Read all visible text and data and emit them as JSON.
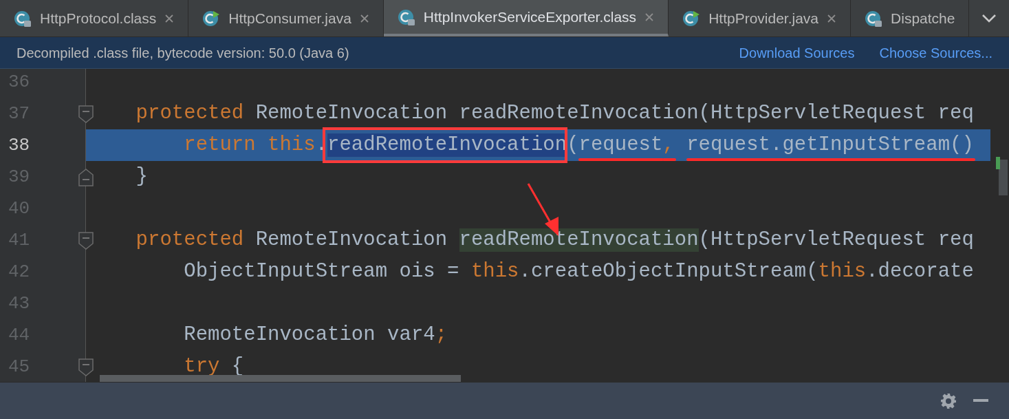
{
  "tabs": [
    {
      "label": "HttpProtocol.class",
      "kind": "class",
      "selected": false,
      "closable": true
    },
    {
      "label": "HttpConsumer.java",
      "kind": "java",
      "selected": false,
      "closable": true
    },
    {
      "label": "HttpInvokerServiceExporter.class",
      "kind": "class",
      "selected": true,
      "closable": true
    },
    {
      "label": "HttpProvider.java",
      "kind": "java",
      "selected": false,
      "closable": true
    },
    {
      "label": "Dispatche",
      "kind": "class",
      "selected": false,
      "closable": false
    }
  ],
  "info_bar": {
    "text": "Decompiled .class file, bytecode version: 50.0 (Java 6)",
    "links": [
      "Download Sources",
      "Choose Sources..."
    ]
  },
  "editor": {
    "lines": [
      {
        "number": "36",
        "selected": false,
        "fold_start": false,
        "fold_end": false
      },
      {
        "number": "37",
        "selected": false,
        "fold_start": true,
        "fold_end": false,
        "tokens": [
          {
            "text": "    protected",
            "kind": "keyword"
          },
          {
            "text": " RemoteInvocation readRemoteInvocation(HttpServletRequest req",
            "kind": "plain"
          }
        ]
      },
      {
        "number": "38",
        "selected": true,
        "fold_start": false,
        "fold_end": false,
        "tokens": [
          {
            "text": "        return this",
            "kind": "keyword"
          },
          {
            "text": ".",
            "kind": "plain"
          },
          {
            "text": "readRemoteInvocation",
            "kind": "plain",
            "boxed": true
          },
          {
            "text": "(",
            "kind": "plain"
          },
          {
            "text": "request",
            "kind": "plain",
            "underlined": true
          },
          {
            "text": ",",
            "kind": "keyword",
            "underlined": true
          },
          {
            "text": " request.getInputStream()",
            "kind": "plain",
            "underlined": true
          }
        ]
      },
      {
        "number": "39",
        "selected": false,
        "fold_start": false,
        "fold_end": true,
        "tokens": [
          {
            "text": "    }",
            "kind": "plain"
          }
        ]
      },
      {
        "number": "40",
        "selected": false,
        "fold_start": false,
        "fold_end": false
      },
      {
        "number": "41",
        "selected": false,
        "fold_start": true,
        "fold_end": false,
        "tokens": [
          {
            "text": "    protected",
            "kind": "keyword"
          },
          {
            "text": " RemoteInvocation ",
            "kind": "plain"
          },
          {
            "text": "readRemoteInvocation",
            "kind": "usage"
          },
          {
            "text": "(HttpServletRequest req",
            "kind": "plain"
          }
        ]
      },
      {
        "number": "42",
        "selected": false,
        "fold_start": false,
        "fold_end": false,
        "tokens": [
          {
            "text": "        ObjectInputStream ois = ",
            "kind": "plain"
          },
          {
            "text": "this",
            "kind": "keyword"
          },
          {
            "text": ".createObjectInputStream(",
            "kind": "plain"
          },
          {
            "text": "this",
            "kind": "keyword"
          },
          {
            "text": ".decorate",
            "kind": "plain"
          }
        ]
      },
      {
        "number": "43",
        "selected": false,
        "fold_start": false,
        "fold_end": false
      },
      {
        "number": "44",
        "selected": false,
        "fold_start": false,
        "fold_end": false,
        "tokens": [
          {
            "text": "        RemoteInvocation var4",
            "kind": "plain"
          },
          {
            "text": ";",
            "kind": "keyword"
          }
        ]
      },
      {
        "number": "45",
        "selected": false,
        "fold_start": true,
        "fold_end": false,
        "tokens": [
          {
            "text": "        try",
            "kind": "keyword"
          },
          {
            "text": " {",
            "kind": "plain"
          }
        ]
      }
    ],
    "annotation_arrow": true
  }
}
